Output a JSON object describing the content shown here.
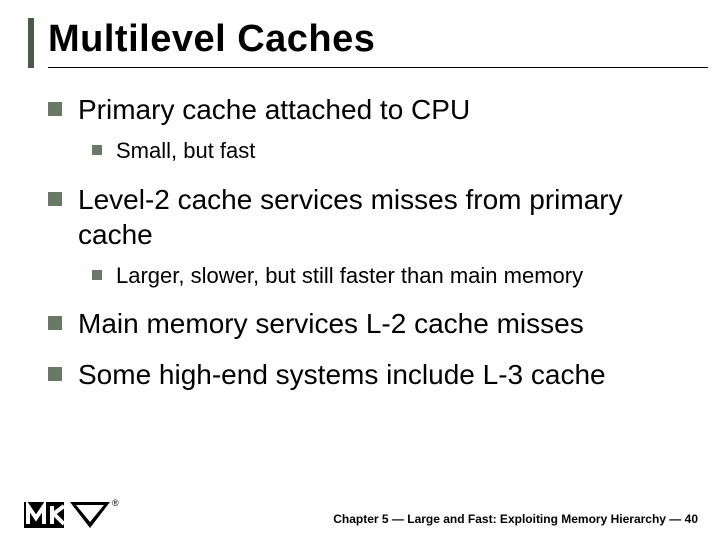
{
  "title": "Multilevel Caches",
  "bullets": {
    "b0": {
      "text": "Primary cache attached to CPU"
    },
    "b0_0": {
      "text": "Small, but fast"
    },
    "b1": {
      "text": "Level-2 cache services misses from primary cache"
    },
    "b1_0": {
      "text": "Larger, slower, but still faster than main memory"
    },
    "b2": {
      "text": "Main memory services L-2 cache misses"
    },
    "b3": {
      "text": "Some high-end systems include L-3 cache"
    }
  },
  "footer": "Chapter 5 — Large and Fast: Exploiting Memory Hierarchy — 40",
  "logo_reg": "®"
}
